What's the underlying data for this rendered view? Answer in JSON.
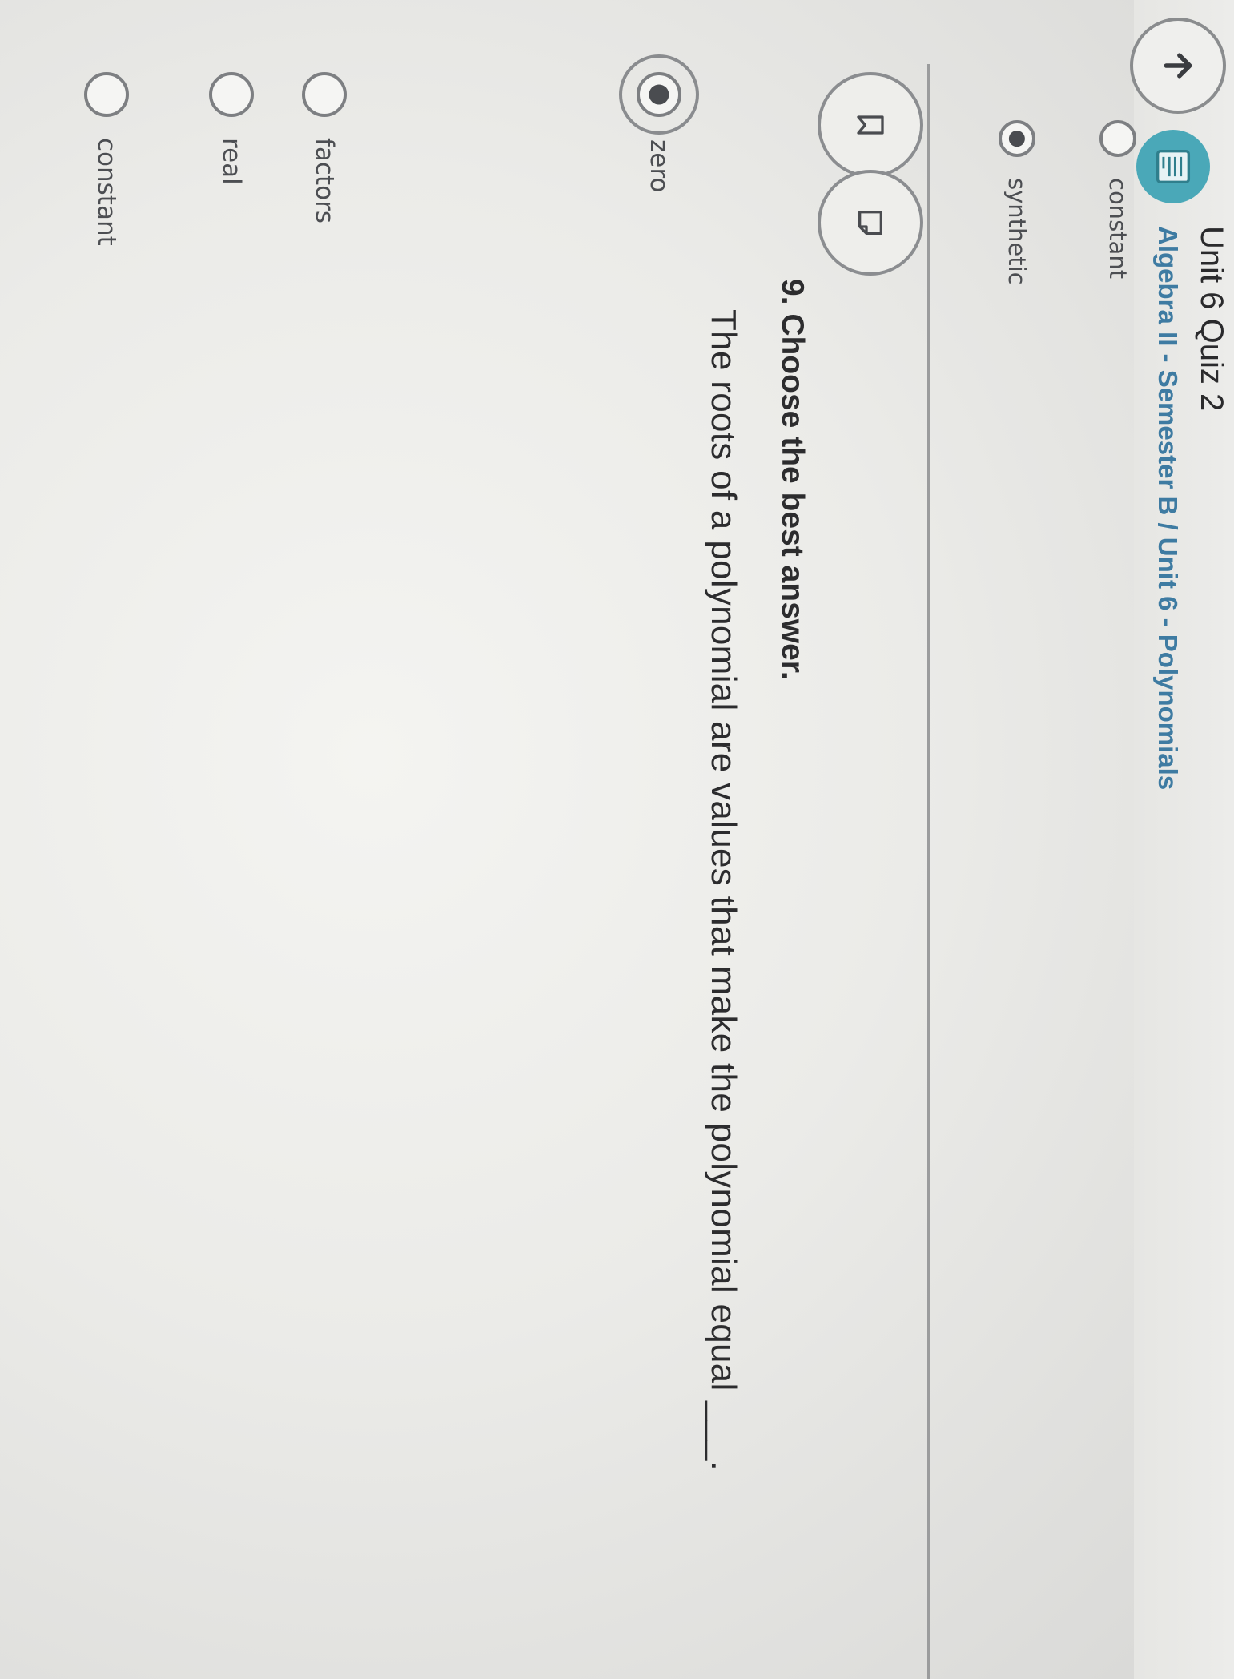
{
  "header": {
    "title": "Unit 6 Quiz 2",
    "breadcrumb": "Algebra II - Semester B / Unit 6 - Polynomials"
  },
  "icons": {
    "back": "arrow-up-icon",
    "course": "course-book-icon",
    "bookmark": "bookmark-icon",
    "flag": "note-icon"
  },
  "previous_question": {
    "options": [
      {
        "label": "constant",
        "selected": false
      },
      {
        "label": "synthetic",
        "selected": true
      }
    ]
  },
  "question": {
    "instruction": "9. Choose the best answer.",
    "text": "The roots of a polynomial are values that make the polynomial equal ___.",
    "options": [
      {
        "label": "zero",
        "selected": true
      },
      {
        "label": "factors",
        "selected": false
      },
      {
        "label": "real",
        "selected": false
      },
      {
        "label": "constant",
        "selected": false
      }
    ]
  },
  "colors": {
    "breadcrumb": "#3e7ba2",
    "course_icon": "#4aa8b8",
    "text": "#2c2c2e"
  }
}
